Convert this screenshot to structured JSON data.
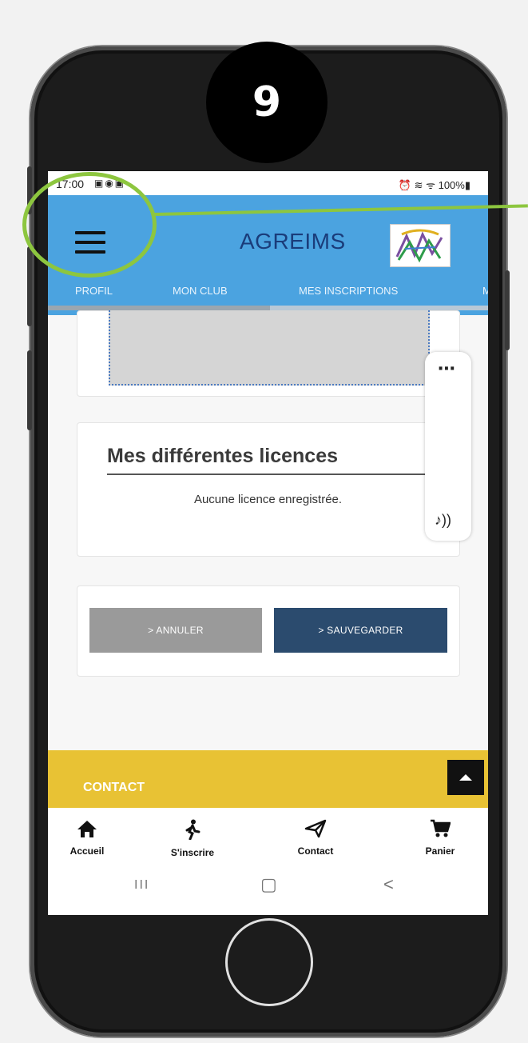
{
  "annotation": {
    "step_number": "9"
  },
  "status_bar": {
    "time": "17:00",
    "left_icons": "▣◉▣",
    "right_text": "⏰ ≋ ᯤ 100%▮"
  },
  "app_bar": {
    "title": "AGREIMS",
    "logo": "club-logo"
  },
  "tabs": [
    "PROFIL",
    "MON CLUB",
    "MES INSCRIPTIONS",
    "M"
  ],
  "licences": {
    "title": "Mes différentes licences",
    "empty_message": "Aucune licence enregistrée."
  },
  "side_toolbar": {
    "more_label": "⋯",
    "sound_label": "♪))"
  },
  "buttons": {
    "cancel": "> ANNULER",
    "save": "> SAUVEGARDER"
  },
  "footer": {
    "contact_heading": "CONTACT"
  },
  "bottom_nav": [
    {
      "label": "Accueil",
      "icon": "home-icon"
    },
    {
      "label": "S'inscrire",
      "icon": "walker-icon"
    },
    {
      "label": "Contact",
      "icon": "send-icon"
    },
    {
      "label": "Panier",
      "icon": "cart-icon"
    }
  ],
  "system_nav": {
    "recents": "III",
    "home": "▢",
    "back": "<"
  },
  "colors": {
    "app_bar": "#4ba3e0",
    "annotation_green": "#8dc63f",
    "contact_bar": "#e8c234",
    "save_button": "#2b4b6e",
    "cancel_button": "#9a9a9a"
  }
}
